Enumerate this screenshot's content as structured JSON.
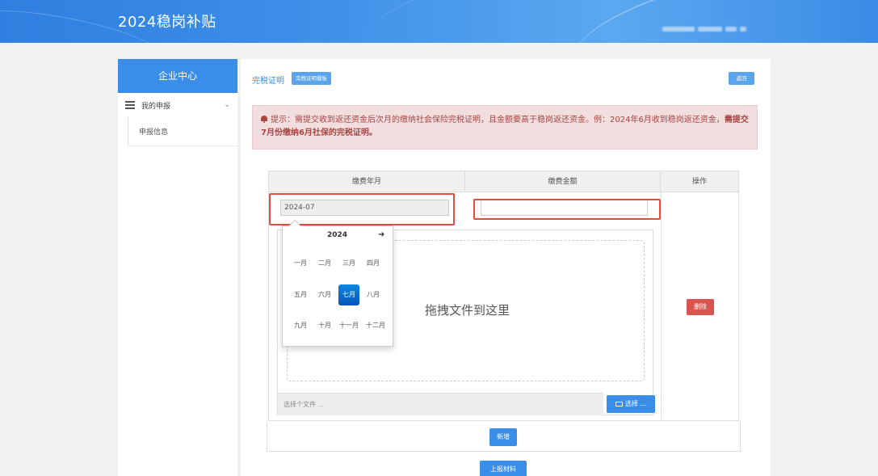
{
  "header": {
    "title": "2024稳岗补贴"
  },
  "sidebar": {
    "title": "企业中心",
    "group_label": "我的申报",
    "group_chevron": "chevron-down-icon",
    "sub_item": "申报信息"
  },
  "main": {
    "breadcrumb": "完税证明",
    "template_button": "完税证明模板",
    "back_button": "返回",
    "alert": {
      "text_prefix": "提示：需提交收到返还资金后次月的缴纳社会保险完税证明，且金额要高于稳岗返还资金。例：2024年6月收到稳岗返还资金，",
      "text_bold": "需提交7月份缴纳6月社保的完税证明。"
    },
    "table": {
      "headers": [
        "缴费年月",
        "缴费金额",
        "操作"
      ],
      "month_value": "2024-07",
      "amount_value": "",
      "dropzone_text": "拖拽文件到这里",
      "file_placeholder": "选择个文件 ...",
      "pick_button": "选择 ...",
      "delete_button": "删除"
    },
    "add_button": "新增",
    "submit_button": "上报材料"
  },
  "datepicker": {
    "year": "2024",
    "next_arrow": "➜",
    "months": [
      "一月",
      "二月",
      "三月",
      "四月",
      "五月",
      "六月",
      "七月",
      "八月",
      "九月",
      "十月",
      "十一月",
      "十二月"
    ],
    "selected": "七月"
  },
  "colors": {
    "primary": "#3b8ee8",
    "danger": "#d9534f",
    "alert_bg": "#f2dede",
    "alert_text": "#a94442",
    "highlight": "#e74c3c"
  }
}
